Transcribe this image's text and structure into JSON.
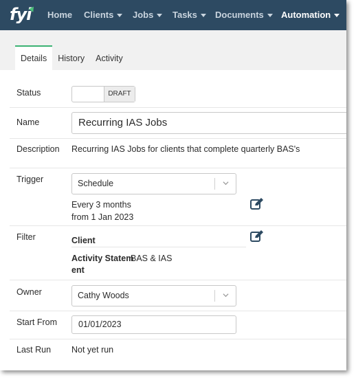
{
  "brand": {
    "logo_text": "fyi"
  },
  "nav": {
    "items": [
      {
        "label": "Home",
        "has_caret": false
      },
      {
        "label": "Clients",
        "has_caret": true
      },
      {
        "label": "Jobs",
        "has_caret": true
      },
      {
        "label": "Tasks",
        "has_caret": true
      },
      {
        "label": "Documents",
        "has_caret": true
      },
      {
        "label": "Automation",
        "has_caret": true,
        "active": true
      }
    ]
  },
  "tabs": [
    {
      "label": "Details",
      "active": true
    },
    {
      "label": "History",
      "active": false
    },
    {
      "label": "Activity",
      "active": false
    }
  ],
  "form": {
    "status": {
      "label": "Status",
      "toggle_text": "DRAFT"
    },
    "name": {
      "label": "Name",
      "value": "Recurring IAS Jobs"
    },
    "description": {
      "label": "Description",
      "value": "Recurring IAS Jobs for clients that complete quarterly BAS's"
    },
    "trigger": {
      "label": "Trigger",
      "selected": "Schedule",
      "summary_line1": "Every 3 months",
      "summary_line2": "from 1 Jan 2023",
      "edit_icon": "edit-icon"
    },
    "filter": {
      "label": "Filter",
      "client_label": "Client",
      "activity_label_line1": "Activity Statem",
      "activity_label_line2": "ent",
      "activity_value": "BAS & IAS",
      "edit_icon": "edit-icon"
    },
    "owner": {
      "label": "Owner",
      "selected": "Cathy Woods"
    },
    "start_from": {
      "label": "Start From",
      "value": "01/01/2023"
    },
    "last_run": {
      "label": "Last Run",
      "value": "Not yet run"
    }
  },
  "colors": {
    "nav_bg": "#2d4a62",
    "nav_text": "#c9d4de",
    "accent_green": "#3bb273",
    "icon_dark": "#2d4a62"
  }
}
